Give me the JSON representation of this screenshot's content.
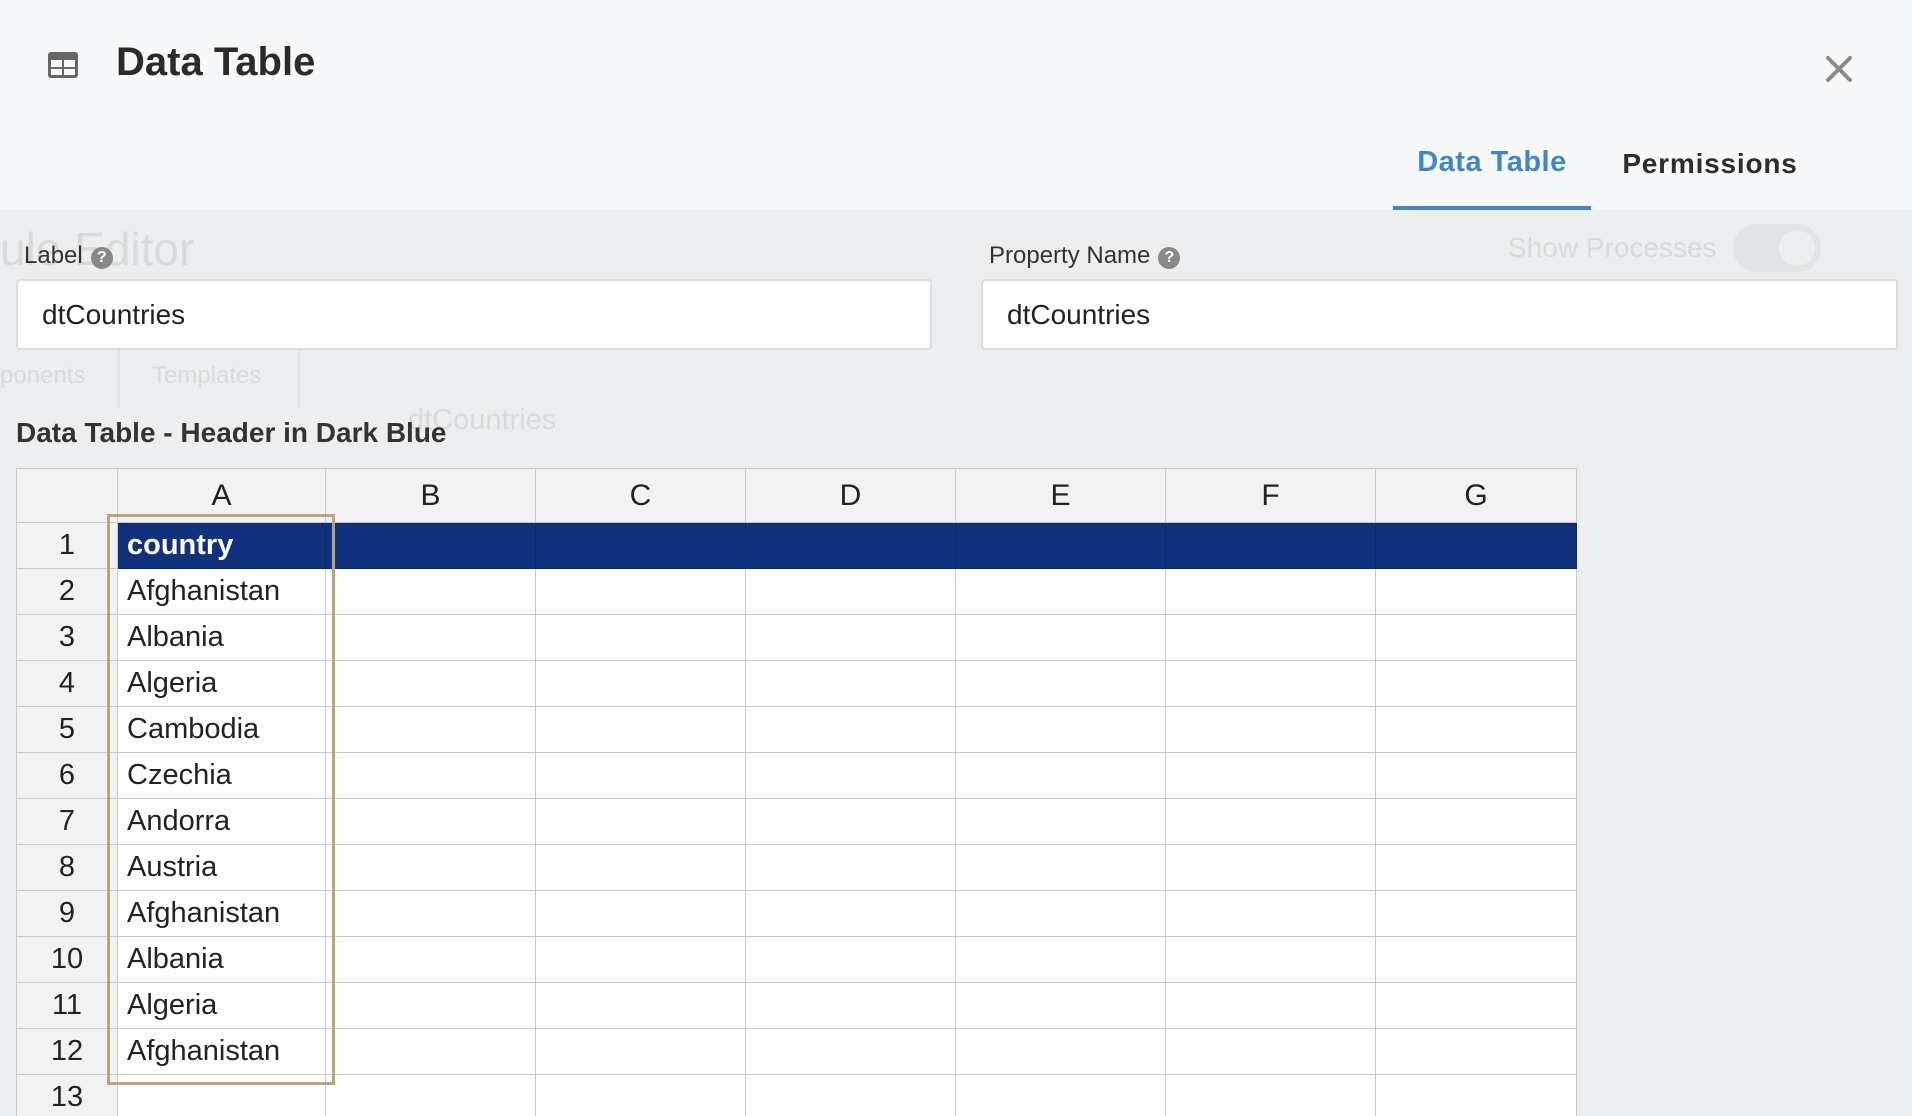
{
  "background": {
    "editor_title": "ule Editor",
    "show_processes_label": "Show Processes",
    "tabs": [
      "ponents",
      "Templates"
    ],
    "selected_value": "dtCountries"
  },
  "header": {
    "icon": "table-icon",
    "title": "Data Table",
    "close_icon": "close-icon",
    "tabs": [
      {
        "label": "Data Table",
        "active": true
      },
      {
        "label": "Permissions",
        "active": false
      }
    ]
  },
  "form": {
    "label": {
      "label": "Label",
      "value": "dtCountries",
      "help_icon": "question-circle-icon"
    },
    "property_name": {
      "label": "Property Name",
      "value": "dtCountries",
      "help_icon": "question-circle-icon"
    }
  },
  "table_caption": "Data Table - Header in Dark Blue",
  "spreadsheet": {
    "columns": [
      "A",
      "B",
      "C",
      "D",
      "E",
      "F",
      "G"
    ],
    "rows": [
      {
        "num": "1",
        "a": "country"
      },
      {
        "num": "2",
        "a": "Afghanistan"
      },
      {
        "num": "3",
        "a": "Albania"
      },
      {
        "num": "4",
        "a": "Algeria"
      },
      {
        "num": "5",
        "a": "Cambodia"
      },
      {
        "num": "6",
        "a": "Czechia"
      },
      {
        "num": "7",
        "a": "Andorra"
      },
      {
        "num": "8",
        "a": "Austria"
      },
      {
        "num": "9",
        "a": "Afghanistan"
      },
      {
        "num": "10",
        "a": "Albania"
      },
      {
        "num": "11",
        "a": "Algeria"
      },
      {
        "num": "12",
        "a": "Afghanistan"
      },
      {
        "num": "13",
        "a": ""
      }
    ],
    "header_row_color": "#12317c",
    "selection_color": "#b5a77a"
  },
  "colors": {
    "accent": "#3f86c8",
    "header_bg": "#f6f8fa",
    "overlay_bg": "#eceeef"
  }
}
